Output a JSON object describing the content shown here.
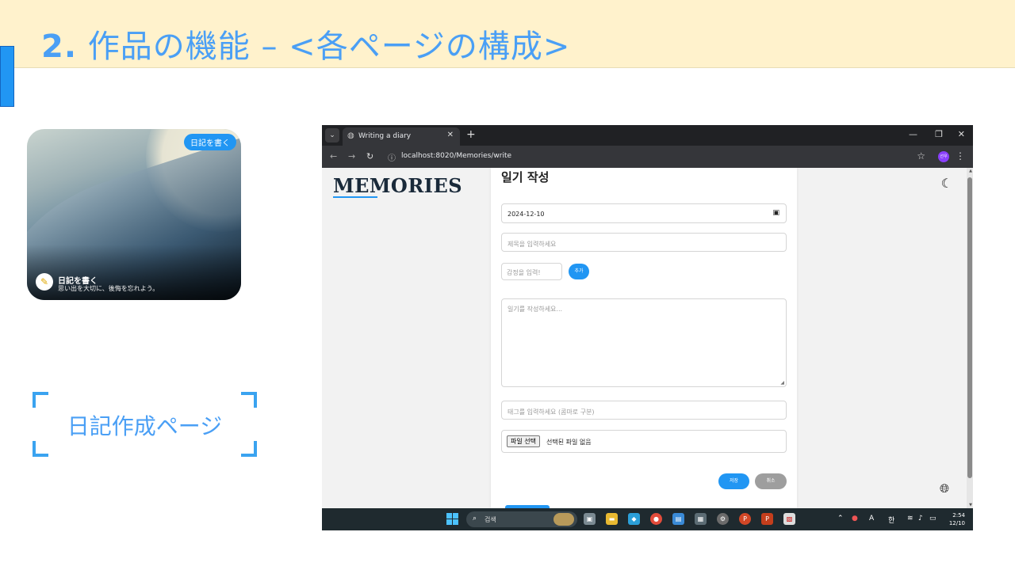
{
  "slide": {
    "title_number": "2.",
    "title_text": " 作品の機能 – <各ページの構成>",
    "bracket_label": "日記作成ページ"
  },
  "card": {
    "pill": "日記を書く",
    "title": "日記を書く",
    "subtitle": "思い出を大切に、後悔を忘れよう。"
  },
  "browser": {
    "tab_title": "Writing a diary",
    "url": "localhost:8020/Memories/write",
    "profile_initials": "선우"
  },
  "page": {
    "logo": "MEMORIES",
    "heading": "일기 작성",
    "date_value": "2024-12-10",
    "title_placeholder": "제목을 입력하세요",
    "emotion_placeholder": "감정을 입력!",
    "add_label": "추가",
    "content_placeholder": "일기를 작성하세요...",
    "tags_placeholder": "태그를 입력하세요 (콤마로 구분)",
    "file_button": "파일 선택",
    "file_status": "선택된 파일 없음",
    "save_label": "저장",
    "cancel_label": "취소"
  },
  "taskbar": {
    "search_label": "검색",
    "ime_label": "A",
    "ime_lang": "한",
    "time": "2:54",
    "date": "12/10"
  },
  "colors": {
    "accent": "#2196f3",
    "slide_title": "#4a9ff5",
    "header_bg": "#fff2cc",
    "cancel": "#9e9e9e"
  }
}
